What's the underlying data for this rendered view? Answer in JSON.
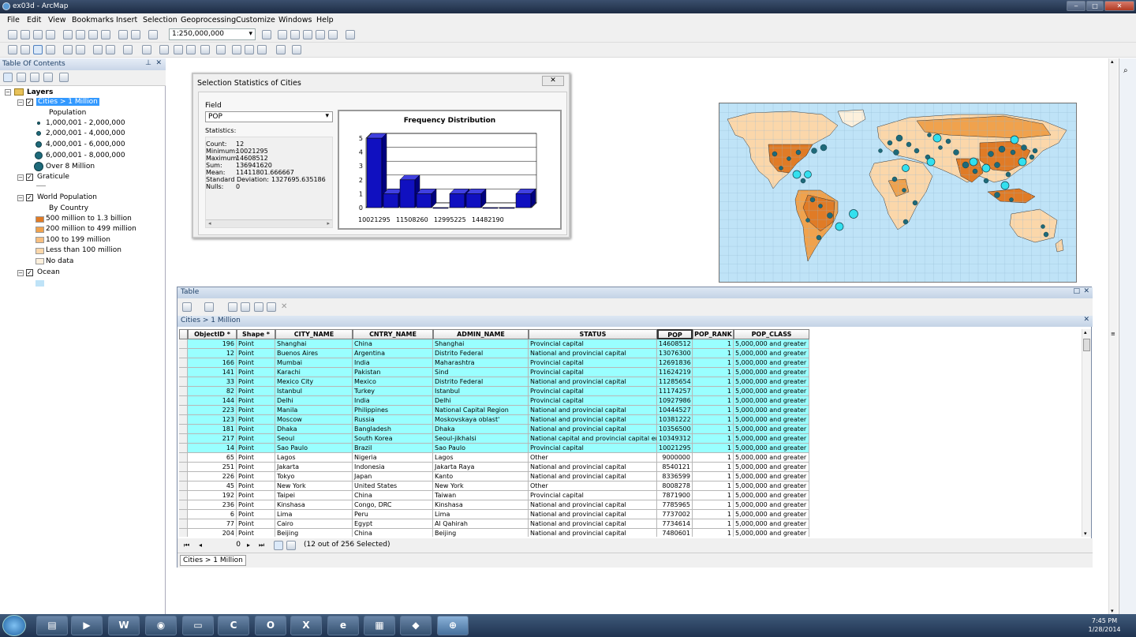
{
  "window": {
    "title": "ex03d - ArcMap"
  },
  "menu": [
    "File",
    "Edit",
    "View",
    "Bookmarks",
    "Insert",
    "Selection",
    "Geoprocessing",
    "Customize",
    "Windows",
    "Help"
  ],
  "toolbar": {
    "scale": "1:250,000,000"
  },
  "toc": {
    "title": "Table Of Contents",
    "root": "Layers",
    "layers": [
      {
        "name": "Cities > 1 Million",
        "field": "Population",
        "classes": [
          "1,000,001 - 2,000,000",
          "2,000,001 - 4,000,000",
          "4,000,001 - 6,000,000",
          "6,000,001 - 8,000,000",
          "Over 8 Million"
        ]
      },
      {
        "name": "Graticule"
      },
      {
        "name": "World Population",
        "field": "By Country",
        "classes": [
          "500 million to 1.3 billion",
          "200 million to 499 million",
          "100 to 199 million",
          "Less than 100 million",
          "No data"
        ],
        "colors": [
          "#e07b26",
          "#f0a24d",
          "#f7bf80",
          "#fbd7aa",
          "#fdf0dc"
        ]
      },
      {
        "name": "Ocean"
      }
    ]
  },
  "dialog": {
    "title": "Selection Statistics of Cities",
    "field_label": "Field",
    "field_value": "POP",
    "stats_label": "Statistics:",
    "stats": [
      [
        "Count:",
        "12"
      ],
      [
        "Minimum:",
        "10021295"
      ],
      [
        "Maximum:",
        "14608512"
      ],
      [
        "Sum:",
        "136941620"
      ],
      [
        "Mean:",
        "11411801.666667"
      ],
      [
        "Standard Deviation:",
        "1327695.635186"
      ],
      [
        "Nulls:",
        "0"
      ]
    ]
  },
  "chart_data": {
    "type": "bar",
    "title": "Frequency Distribution",
    "values": [
      5,
      1,
      2,
      1,
      0,
      1,
      1,
      0,
      0,
      1
    ],
    "ylim": [
      0,
      5
    ],
    "yticks": [
      0,
      1,
      2,
      3,
      4,
      5
    ],
    "xtick_labels": [
      "10021295",
      "11508260",
      "12995225",
      "14482190"
    ],
    "bar_color": "#1010c0"
  },
  "table": {
    "window_title": "Table",
    "tab_title": "Cities > 1 Million",
    "columns": [
      "ObjectID *",
      "Shape *",
      "CITY_NAME",
      "CNTRY_NAME",
      "ADMIN_NAME",
      "STATUS",
      "POP",
      "POP_RANK",
      "POP_CLASS"
    ],
    "rows": [
      [
        "196",
        "Point",
        "Shanghai",
        "China",
        "Shanghai",
        "Provincial capital",
        "14608512",
        "1",
        "5,000,000 and greater"
      ],
      [
        "12",
        "Point",
        "Buenos Aires",
        "Argentina",
        "Distrito Federal",
        "National and provincial capital",
        "13076300",
        "1",
        "5,000,000 and greater"
      ],
      [
        "166",
        "Point",
        "Mumbai",
        "India",
        "Maharashtra",
        "Provincial capital",
        "12691836",
        "1",
        "5,000,000 and greater"
      ],
      [
        "141",
        "Point",
        "Karachi",
        "Pakistan",
        "Sind",
        "Provincial capital",
        "11624219",
        "1",
        "5,000,000 and greater"
      ],
      [
        "33",
        "Point",
        "Mexico City",
        "Mexico",
        "Distrito Federal",
        "National and provincial capital",
        "11285654",
        "1",
        "5,000,000 and greater"
      ],
      [
        "82",
        "Point",
        "Istanbul",
        "Turkey",
        "Istanbul",
        "Provincial capital",
        "11174257",
        "1",
        "5,000,000 and greater"
      ],
      [
        "144",
        "Point",
        "Delhi",
        "India",
        "Delhi",
        "Provincial capital",
        "10927986",
        "1",
        "5,000,000 and greater"
      ],
      [
        "223",
        "Point",
        "Manila",
        "Philippines",
        "National Capital Region",
        "National and provincial capital",
        "10444527",
        "1",
        "5,000,000 and greater"
      ],
      [
        "123",
        "Point",
        "Moscow",
        "Russia",
        "Moskovskaya oblast'",
        "National and provincial capital",
        "10381222",
        "1",
        "5,000,000 and greater"
      ],
      [
        "181",
        "Point",
        "Dhaka",
        "Bangladesh",
        "Dhaka",
        "National and provincial capital",
        "10356500",
        "1",
        "5,000,000 and greater"
      ],
      [
        "217",
        "Point",
        "Seoul",
        "South Korea",
        "Seoul-jikhalsi",
        "National capital and provincial capital enclav",
        "10349312",
        "1",
        "5,000,000 and greater"
      ],
      [
        "14",
        "Point",
        "Sao Paulo",
        "Brazil",
        "Sao Paulo",
        "Provincial capital",
        "10021295",
        "1",
        "5,000,000 and greater"
      ],
      [
        "65",
        "Point",
        "Lagos",
        "Nigeria",
        "Lagos",
        "Other",
        "9000000",
        "1",
        "5,000,000 and greater"
      ],
      [
        "251",
        "Point",
        "Jakarta",
        "Indonesia",
        "Jakarta Raya",
        "National and provincial capital",
        "8540121",
        "1",
        "5,000,000 and greater"
      ],
      [
        "226",
        "Point",
        "Tokyo",
        "Japan",
        "Kanto",
        "National and provincial capital",
        "8336599",
        "1",
        "5,000,000 and greater"
      ],
      [
        "45",
        "Point",
        "New York",
        "United States",
        "New York",
        "Other",
        "8008278",
        "1",
        "5,000,000 and greater"
      ],
      [
        "192",
        "Point",
        "Taipei",
        "China",
        "Taiwan",
        "Provincial capital",
        "7871900",
        "1",
        "5,000,000 and greater"
      ],
      [
        "236",
        "Point",
        "Kinshasa",
        "Congo, DRC",
        "Kinshasa",
        "National and provincial capital",
        "7785965",
        "1",
        "5,000,000 and greater"
      ],
      [
        "6",
        "Point",
        "Lima",
        "Peru",
        "Lima",
        "National and provincial capital",
        "7737002",
        "1",
        "5,000,000 and greater"
      ],
      [
        "77",
        "Point",
        "Cairo",
        "Egypt",
        "Al Qahirah",
        "National and provincial capital",
        "7734614",
        "1",
        "5,000,000 and greater"
      ],
      [
        "204",
        "Point",
        "Beijing",
        "China",
        "Beijing",
        "National and provincial capital",
        "7480601",
        "1",
        "5,000,000 and greater"
      ]
    ],
    "selected_count": 12,
    "record_index": "0",
    "selection_status": "(12 out of 256 Selected)",
    "bottom_tab": "Cities > 1 Million"
  },
  "clock": {
    "time": "7:45 PM",
    "date": "1/28/2014"
  },
  "colors": {
    "selection": "#99ffff",
    "ocean": "#bfe3f7",
    "city_dot": "#1e6a7a",
    "city_highlight": "#33e0ef"
  }
}
